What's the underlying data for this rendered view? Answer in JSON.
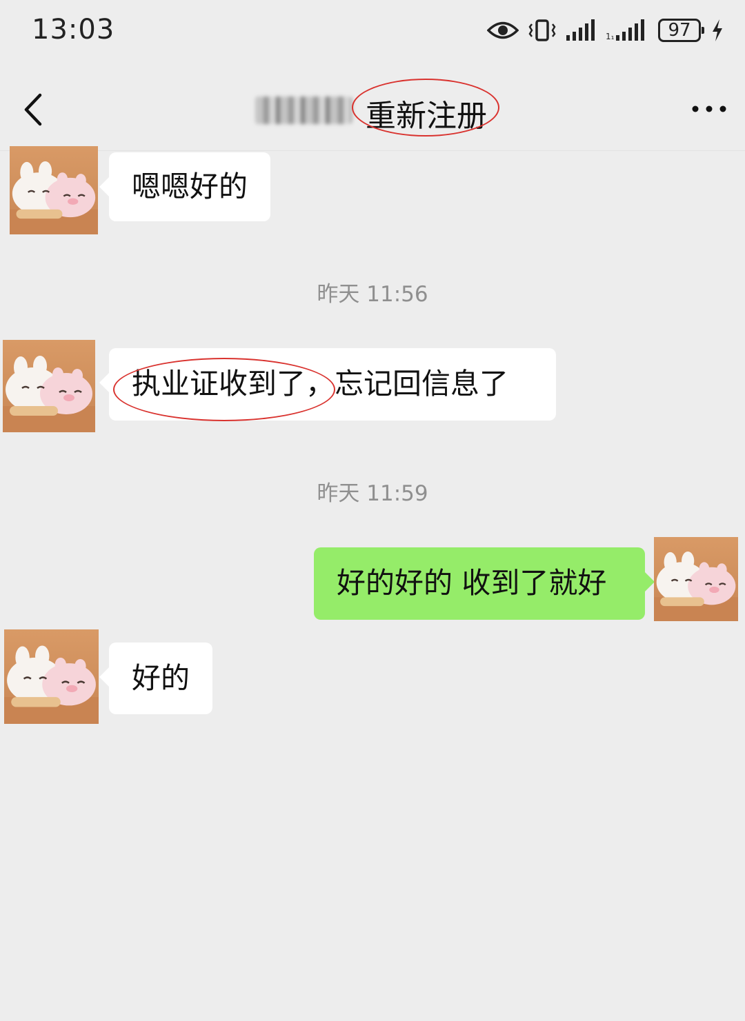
{
  "status_bar": {
    "time": "13:03",
    "battery_level": "97",
    "icons": [
      "eye-icon",
      "vibrate-icon",
      "signal-icon",
      "signal-icon",
      "battery-icon",
      "charging-icon"
    ]
  },
  "header": {
    "title": "重新注册",
    "back_icon": "chevron-left-icon",
    "more_icon": "more-dots-icon"
  },
  "messages": [
    {
      "side": "left",
      "text": "嗯嗯好的"
    },
    {
      "type": "time",
      "text": "昨天 11:56"
    },
    {
      "side": "left",
      "text": "执业证收到了，忘记回信息了"
    },
    {
      "type": "time",
      "text": "昨天 11:59"
    },
    {
      "side": "right",
      "text": "好的好的 收到了就好"
    },
    {
      "side": "left",
      "text": "好的"
    }
  ],
  "colors": {
    "background": "#ededed",
    "bubble_left": "#ffffff",
    "bubble_right": "#95ec69",
    "annotation": "#d9322e"
  }
}
